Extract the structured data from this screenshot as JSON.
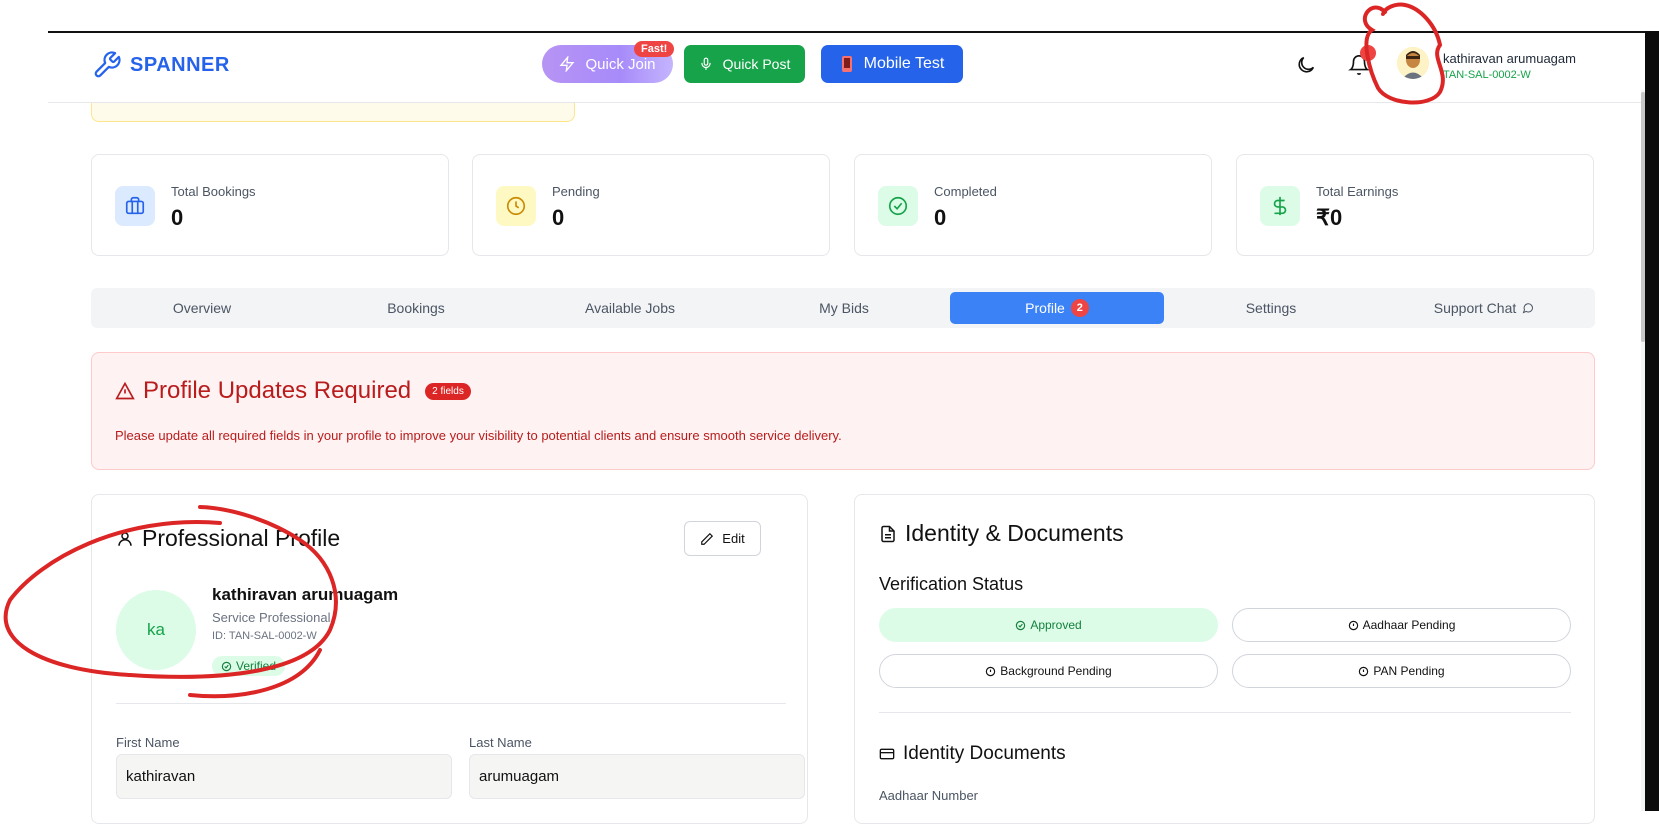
{
  "header": {
    "logo_text": "SPANNER",
    "quick_join_label": "Quick Join",
    "fast_badge": "Fast!",
    "quick_post_label": "Quick Post",
    "mobile_test_label": "Mobile Test",
    "user_name": "kathiravan arumuagam",
    "user_id": "TAN-SAL-0002-W"
  },
  "stats": [
    {
      "label": "Total Bookings",
      "value": "0",
      "icon": "briefcase-icon"
    },
    {
      "label": "Pending",
      "value": "0",
      "icon": "clock-icon"
    },
    {
      "label": "Completed",
      "value": "0",
      "icon": "check-circle-icon"
    },
    {
      "label": "Total Earnings",
      "value": "₹0",
      "icon": "dollar-icon"
    }
  ],
  "tabs": [
    {
      "label": "Overview"
    },
    {
      "label": "Bookings"
    },
    {
      "label": "Available Jobs"
    },
    {
      "label": "My Bids"
    },
    {
      "label": "Profile",
      "badge": "2",
      "active": true
    },
    {
      "label": "Settings"
    },
    {
      "label": "Support Chat"
    }
  ],
  "alert": {
    "title": "Profile Updates Required",
    "badge": "2 fields",
    "text": "Please update all required fields in your profile to improve your visibility to potential clients and ensure smooth service delivery."
  },
  "profile": {
    "title": "Professional Profile",
    "edit_label": "Edit",
    "initials": "ka",
    "name": "kathiravan arumuagam",
    "role": "Service Professional",
    "id": "ID: TAN-SAL-0002-W",
    "verified": "Verified",
    "first_name_label": "First Name",
    "first_name": "kathiravan",
    "last_name_label": "Last Name",
    "last_name": "arumuagam"
  },
  "documents": {
    "title": "Identity & Documents",
    "verification_status": "Verification Status",
    "pills": [
      "Approved",
      "Aadhaar Pending",
      "Background Pending",
      "PAN Pending"
    ],
    "identity_docs": "Identity Documents",
    "aadhaar_label": "Aadhaar Number"
  },
  "colors": {
    "brand": "#2563eb",
    "active_tab": "#3b82f6",
    "alert_red": "#b91c1c",
    "success": "#16a34a"
  }
}
